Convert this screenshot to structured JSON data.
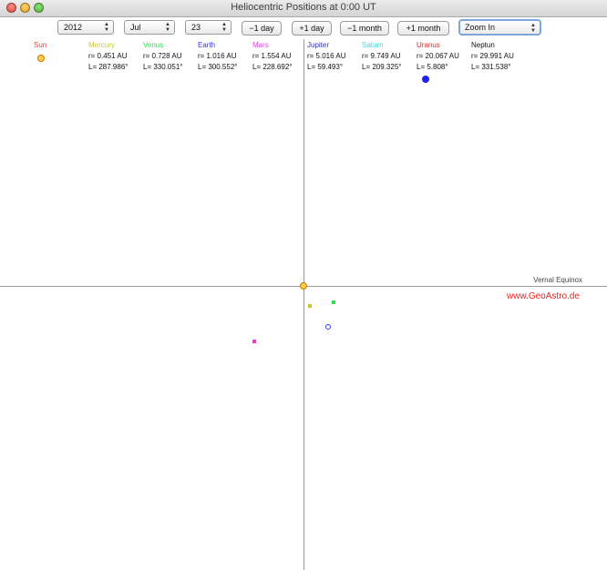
{
  "window": {
    "title": "Heliocentric Positions at 0:00 UT"
  },
  "controls": {
    "year": "2012",
    "month": "Jul",
    "day": "23",
    "minus_day": "−1 day",
    "plus_day": "+1 day",
    "minus_month": "−1 month",
    "plus_month": "+1 month",
    "zoom": "Zoom In"
  },
  "planets": [
    {
      "name": "Sun",
      "color": "#ff3333",
      "r": "",
      "l": ""
    },
    {
      "name": "Mercury",
      "color": "#c8c830",
      "r": "r= 0.451 AU",
      "l": "L= 287.986°"
    },
    {
      "name": "Venus",
      "color": "#33dd55",
      "r": "r= 0.728 AU",
      "l": "L= 330.051°"
    },
    {
      "name": "Earth",
      "color": "#3333ff",
      "r": "r= 1.016 AU",
      "l": "L= 300.552°"
    },
    {
      "name": "Mars",
      "color": "#ff33ff",
      "r": "r= 1.554 AU",
      "l": "L= 228.692°"
    },
    {
      "name": "Jupiter",
      "color": "#3333cc",
      "r": "r= 5.016 AU",
      "l": "L= 59.493°"
    },
    {
      "name": "Saturn",
      "color": "#33dddd",
      "r": "r= 9.749 AU",
      "l": "L= 209.325°"
    },
    {
      "name": "Uranus",
      "color": "#ee2222",
      "r": "r= 20.067 AU",
      "l": "L= 5.808°"
    },
    {
      "name": "Neptun",
      "color": "#111111",
      "r": "r= 29.991 AU",
      "l": "L= 331.538°"
    }
  ],
  "labels": {
    "vernal_equinox": "Vernal Equinox",
    "credit": "www.GeoAstro.de"
  }
}
